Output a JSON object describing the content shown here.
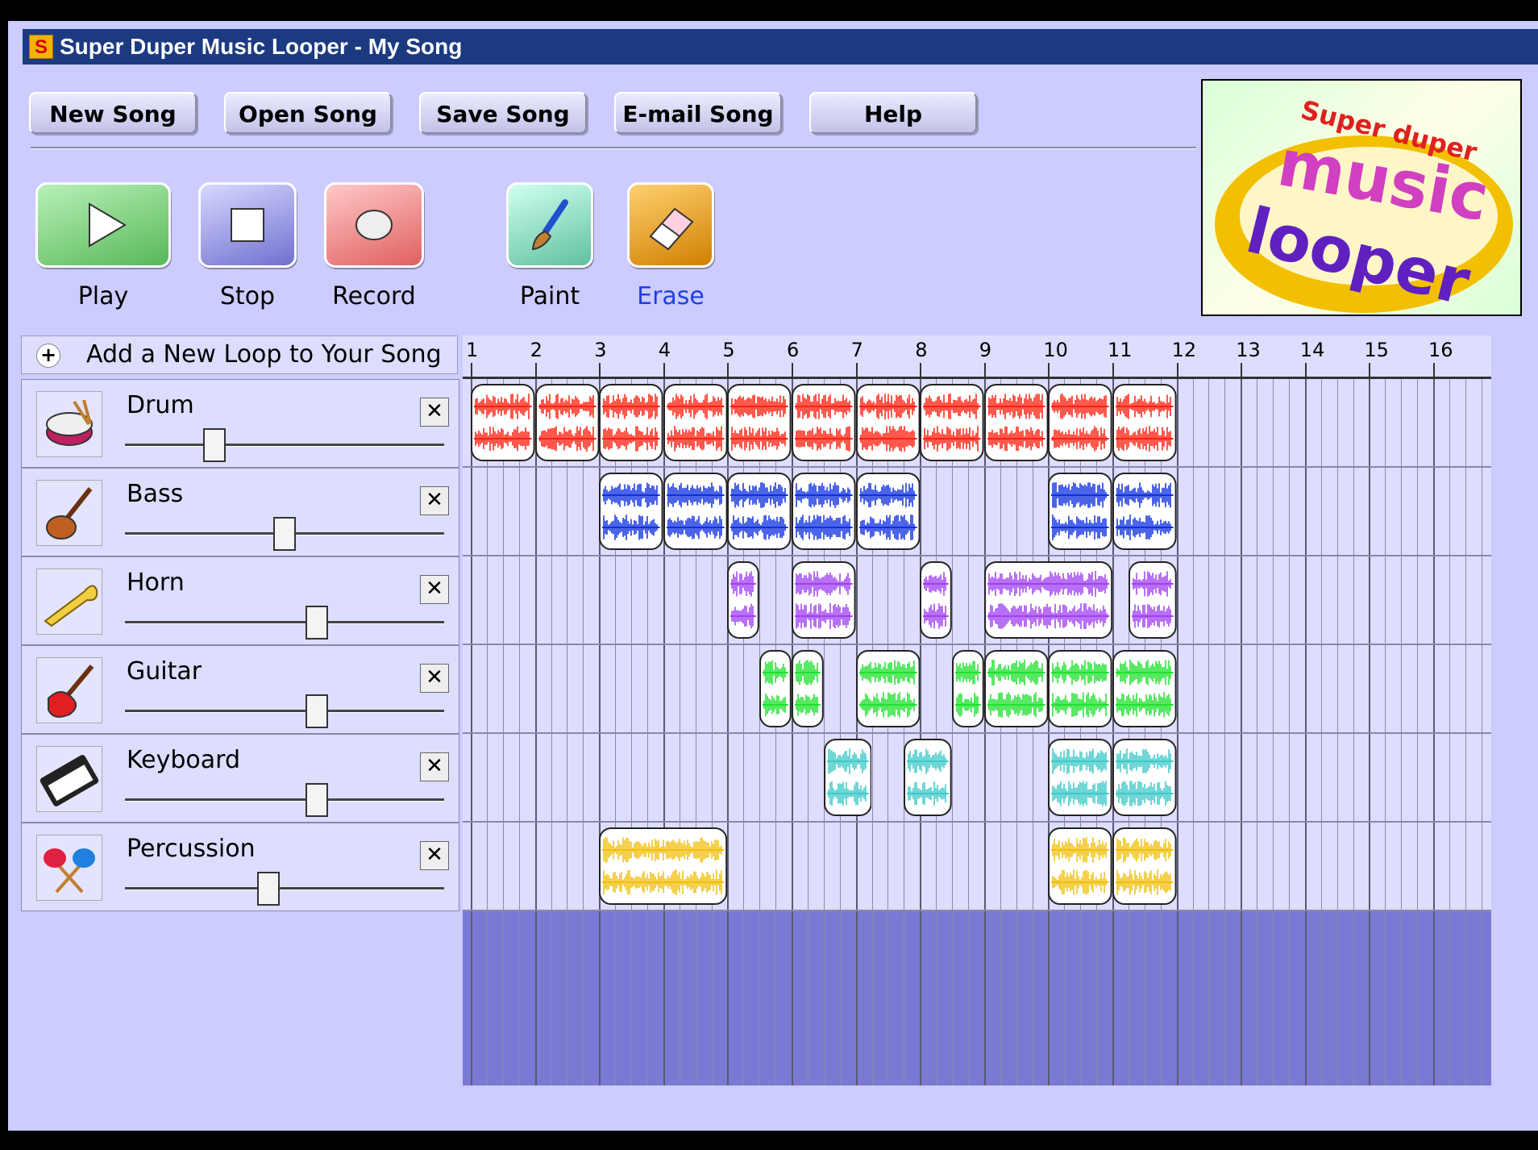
{
  "window": {
    "app_icon_letter": "S",
    "title": "Super Duper Music Looper - My Song"
  },
  "menu": {
    "new_song": "New Song",
    "open_song": "Open Song",
    "save_song": "Save Song",
    "email_song": "E-mail Song",
    "help": "Help"
  },
  "tools": {
    "play": "Play",
    "stop": "Stop",
    "record": "Record",
    "paint": "Paint",
    "erase": "Erase",
    "active_tool": "Erase"
  },
  "logo": {
    "line1": "Super duper",
    "line2": "music",
    "line3": "looper"
  },
  "add_loop": {
    "label": "Add a New Loop to Your Song"
  },
  "ruler": {
    "measures": [
      "1",
      "2",
      "3",
      "4",
      "5",
      "6",
      "7",
      "8",
      "9",
      "10",
      "11",
      "12",
      "13",
      "14",
      "15",
      "16"
    ]
  },
  "tracks": [
    {
      "name": "Drum",
      "icon": "drum-icon",
      "color": "#ff2010",
      "volume": 0.28,
      "clips": [
        [
          1,
          2
        ],
        [
          2,
          3
        ],
        [
          3,
          4
        ],
        [
          4,
          5
        ],
        [
          5,
          6
        ],
        [
          6,
          7
        ],
        [
          7,
          8
        ],
        [
          8,
          9
        ],
        [
          9,
          10
        ],
        [
          10,
          11
        ],
        [
          11,
          12
        ]
      ]
    },
    {
      "name": "Bass",
      "icon": "bass-guitar-icon",
      "color": "#1030e0",
      "volume": 0.5,
      "clips": [
        [
          3,
          4
        ],
        [
          4,
          5
        ],
        [
          5,
          6
        ],
        [
          6,
          7
        ],
        [
          7,
          8
        ],
        [
          10,
          11
        ],
        [
          11,
          12
        ]
      ]
    },
    {
      "name": "Horn",
      "icon": "horn-icon",
      "color": "#a040f0",
      "volume": 0.6,
      "clips": [
        [
          5,
          5.5
        ],
        [
          6,
          7
        ],
        [
          8,
          8.5
        ],
        [
          9,
          11
        ],
        [
          11.25,
          12
        ]
      ]
    },
    {
      "name": "Guitar",
      "icon": "electric-guitar-icon",
      "color": "#20e030",
      "volume": 0.6,
      "clips": [
        [
          5.5,
          6
        ],
        [
          6,
          6.5
        ],
        [
          7,
          8
        ],
        [
          8.5,
          9
        ],
        [
          9,
          10
        ],
        [
          10,
          11
        ],
        [
          11,
          12
        ]
      ]
    },
    {
      "name": "Keyboard",
      "icon": "keyboard-icon",
      "color": "#40c8c8",
      "volume": 0.6,
      "clips": [
        [
          6.5,
          7.25
        ],
        [
          7.75,
          8.5
        ],
        [
          10,
          11
        ],
        [
          11,
          12
        ]
      ]
    },
    {
      "name": "Percussion",
      "icon": "maracas-icon",
      "color": "#f0c010",
      "volume": 0.45,
      "clips": [
        [
          3,
          5
        ],
        [
          10,
          11
        ],
        [
          11,
          12
        ]
      ]
    }
  ]
}
